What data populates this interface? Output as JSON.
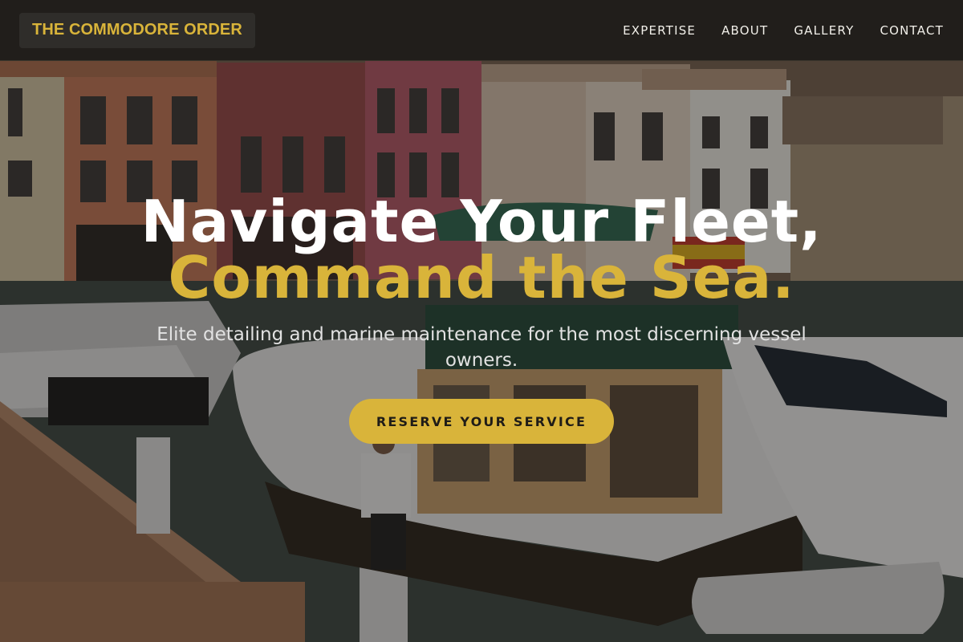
{
  "brand": {
    "name": "THE COMMODORE ORDER"
  },
  "nav": {
    "items": [
      {
        "label": "EXPERTISE"
      },
      {
        "label": "ABOUT"
      },
      {
        "label": "GALLERY"
      },
      {
        "label": "CONTACT"
      }
    ]
  },
  "hero": {
    "headline_line1": "Navigate Your Fleet,",
    "headline_line2": "Command the Sea.",
    "subtitle": "Elite detailing and marine maintenance for the most discerning vessel owners.",
    "cta_label": "RESERVE YOUR SERVICE",
    "background_image": "marina-harbor-photo"
  },
  "colors": {
    "accent": "#d9b43a",
    "nav_background": "#1e1c1a",
    "headline_white": "#ffffff",
    "subtitle_text": "#e2e2e2",
    "button_text": "#1f1c17"
  }
}
